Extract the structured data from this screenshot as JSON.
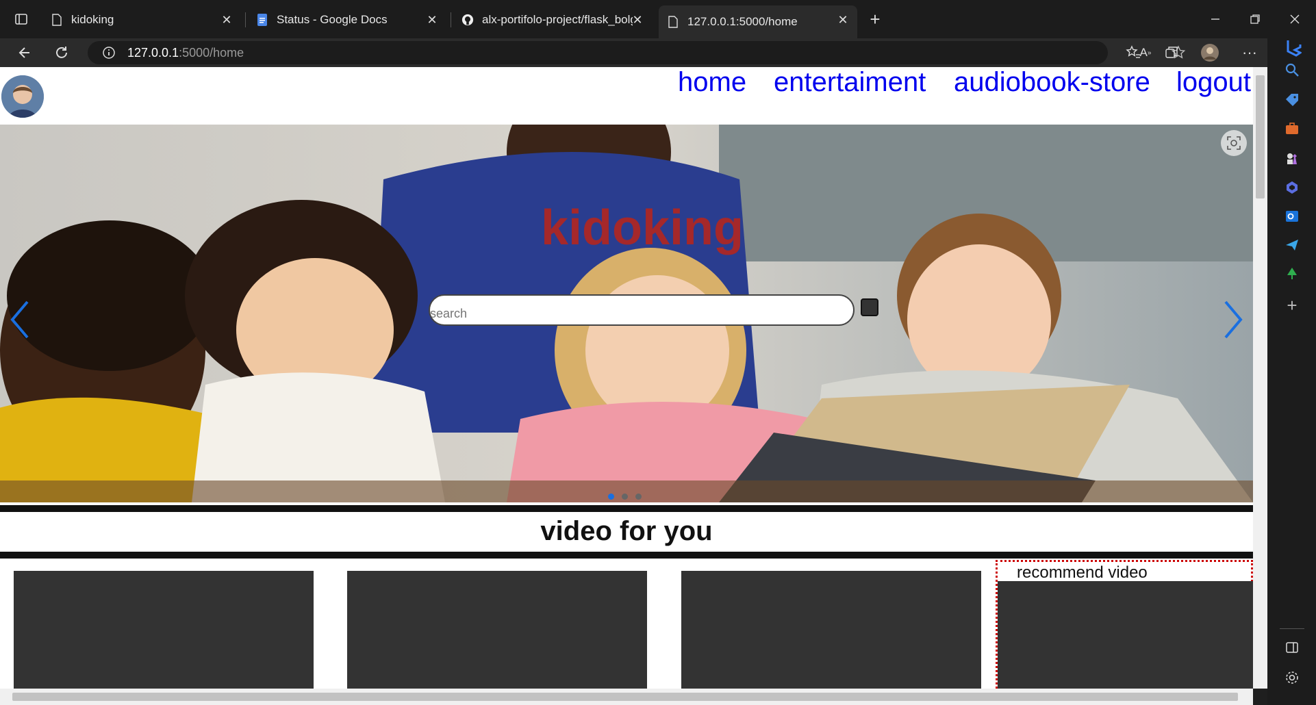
{
  "browser": {
    "tabs": [
      {
        "title": "kidoking",
        "icon": "page-icon",
        "active": false
      },
      {
        "title": "Status - Google Docs",
        "icon": "google-docs-icon",
        "active": false
      },
      {
        "title": "alx-portifolo-project/flask_bolg",
        "icon": "github-icon",
        "active": false
      },
      {
        "title": "127.0.0.1:5000/home",
        "icon": "page-icon",
        "active": true
      }
    ],
    "url_host": "127.0.0.1",
    "url_rest": ":5000/home"
  },
  "page": {
    "nav": [
      "home",
      "entertaiment",
      "audiobook-store",
      "logout"
    ],
    "hero_title": "kidoking",
    "search_placeholder": "search",
    "section_title": "video for you",
    "recommend_title": "recommend video",
    "carousel_dots": 3,
    "carousel_active": 0
  },
  "colors": {
    "hero_title": "#a5282a",
    "link": "#0000ee",
    "card": "#333333"
  }
}
